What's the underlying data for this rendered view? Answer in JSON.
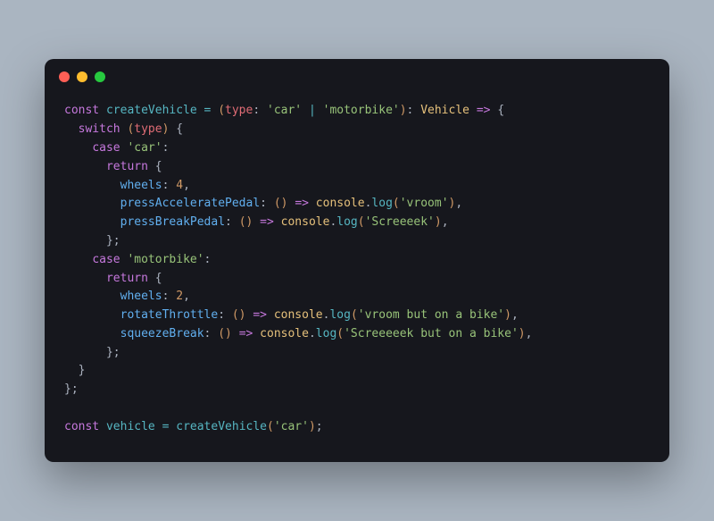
{
  "code": {
    "l1": {
      "kw1": "const",
      "fn": "createVehicle",
      "op": "=",
      "param": "type",
      "colon": ":",
      "str1": "'car'",
      "pipe": "|",
      "str2": "'motorbike'",
      "colon2": ":",
      "type": "Vehicle",
      "arrow": "=>",
      "brace": "{"
    },
    "l2": {
      "kw": "switch",
      "param": "type",
      "brace": "{"
    },
    "l3": {
      "kw": "case",
      "str": "'car'",
      "colon": ":"
    },
    "l4": {
      "kw": "return",
      "brace": "{"
    },
    "l5": {
      "prop": "wheels",
      "colon": ":",
      "num": "4",
      "comma": ","
    },
    "l6": {
      "prop": "pressAcceleratePedal",
      "colon": ":",
      "arrow": "=>",
      "obj": "console",
      "dot": ".",
      "method": "log",
      "str": "'vroom'",
      "comma": ","
    },
    "l7": {
      "prop": "pressBreakPedal",
      "colon": ":",
      "arrow": "=>",
      "obj": "console",
      "dot": ".",
      "method": "log",
      "str": "'Screeeek'",
      "comma": ","
    },
    "l8": {
      "brace": "};"
    },
    "l9": {
      "kw": "case",
      "str": "'motorbike'",
      "colon": ":"
    },
    "l10": {
      "kw": "return",
      "brace": "{"
    },
    "l11": {
      "prop": "wheels",
      "colon": ":",
      "num": "2",
      "comma": ","
    },
    "l12": {
      "prop": "rotateThrottle",
      "colon": ":",
      "arrow": "=>",
      "obj": "console",
      "dot": ".",
      "method": "log",
      "str": "'vroom but on a bike'",
      "comma": ","
    },
    "l13": {
      "prop": "squeezeBreak",
      "colon": ":",
      "arrow": "=>",
      "obj": "console",
      "dot": ".",
      "method": "log",
      "str": "'Screeeeek but on a bike'",
      "comma": ","
    },
    "l14": {
      "brace": "};"
    },
    "l15": {
      "brace": "}"
    },
    "l16": {
      "brace": "};"
    },
    "l17": {
      "kw": "const",
      "var": "vehicle",
      "op": "=",
      "fn": "createVehicle",
      "str": "'car'",
      "semi": ";"
    }
  }
}
